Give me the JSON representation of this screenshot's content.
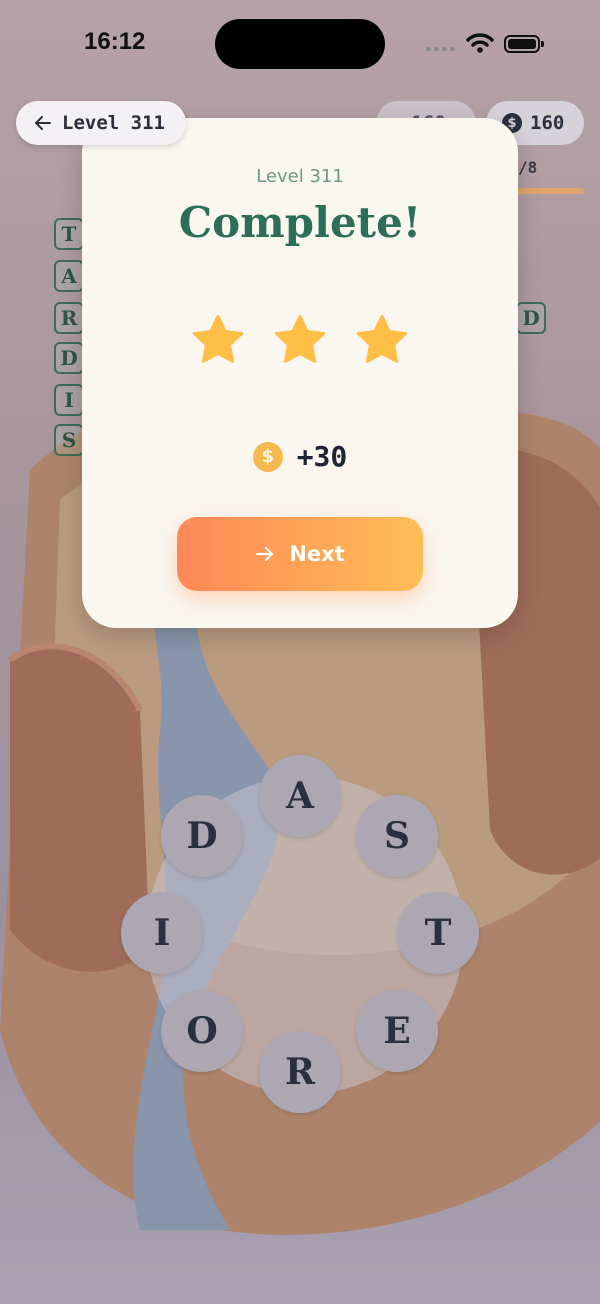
{
  "status_bar": {
    "time": "16:12"
  },
  "header": {
    "back_label": "Level 311",
    "stars_count": "160",
    "coins_count": "160",
    "progress_text": "/8"
  },
  "board": {
    "tile_letters": [
      "T",
      "A",
      "R",
      "D",
      "I",
      "S"
    ],
    "right_tile": "D"
  },
  "wheel": {
    "letters": [
      "A",
      "S",
      "T",
      "E",
      "R",
      "O",
      "I",
      "D"
    ]
  },
  "modal": {
    "level_label": "Level 311",
    "title": "Complete!",
    "stars_earned": 3,
    "stars_total": 3,
    "reward_text": "+30",
    "next_label": "Next"
  },
  "colors": {
    "title_green": "#2d6e5a",
    "star_gold": "#ffbf47",
    "button_start": "#ff8756",
    "button_end": "#ffbe56"
  },
  "icons": [
    "back-arrow-icon",
    "star-icon",
    "coin-icon",
    "next-arrow-icon",
    "wifi-icon",
    "battery-icon"
  ]
}
